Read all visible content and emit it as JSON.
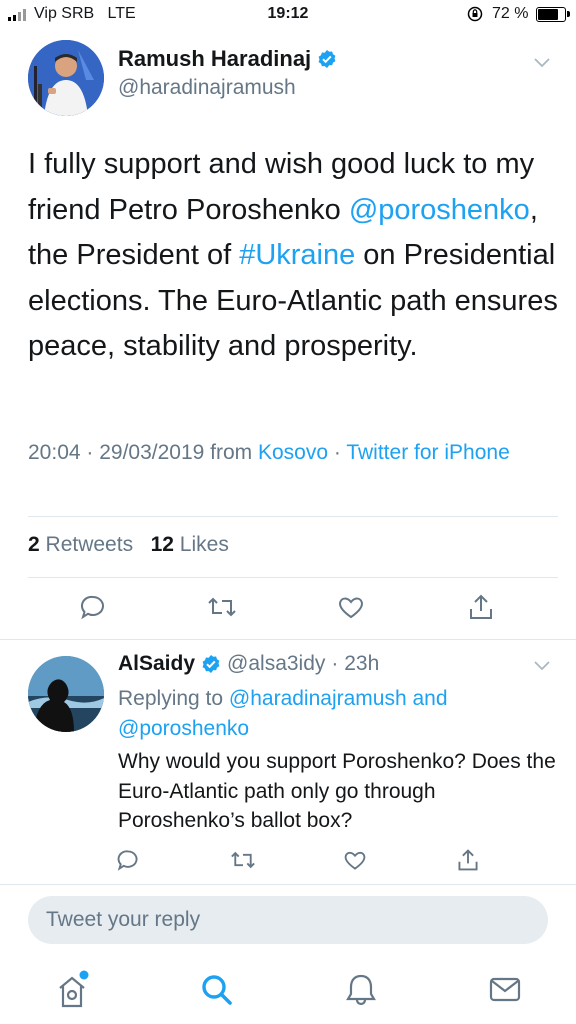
{
  "status_bar": {
    "carrier": "Vip SRB",
    "network": "LTE",
    "time": "19:12",
    "battery_percent": "72 %",
    "battery_level": 0.72
  },
  "tweet": {
    "author_name": "Ramush Haradinaj",
    "author_handle": "@haradinajramush",
    "verified": true,
    "text_parts": {
      "p1": "I fully support and wish good luck to my friend Petro Poroshenko ",
      "mention": "@poroshenko",
      "p2": ", the President of ",
      "hashtag": "#Ukraine",
      "p3": " on Presidential elections. The Euro-Atlantic path ensures peace, stability and prosperity."
    },
    "timestamp": "20:04 · 29/03/2019 from ",
    "location": "Kosovo",
    "separator": " · ",
    "client": "Twitter for iPhone",
    "retweets_count": "2",
    "retweets_label": "Retweets",
    "likes_count": "12",
    "likes_label": "Likes"
  },
  "reply": {
    "author_name": "AlSaidy",
    "author_handle": "@alsa3idy",
    "time": "· 23h",
    "verified": true,
    "replying_prefix": "Replying to ",
    "replying_user1": "@haradinajramush",
    "replying_and": " and",
    "replying_user2": "@poroshenko",
    "text": "Why would you support Poroshenko? Does the Euro-Atlantic path only go through Poroshenko’s ballot box?"
  },
  "composer": {
    "placeholder": "Tweet your reply"
  },
  "tabbar": {
    "items": [
      "home-icon",
      "search-icon",
      "notifications-icon",
      "messages-icon"
    ]
  },
  "colors": {
    "accent": "#1da1f2",
    "secondary_text": "#657786",
    "divider": "#e1e8ed",
    "reply_box_bg": "#e6ecf0"
  }
}
